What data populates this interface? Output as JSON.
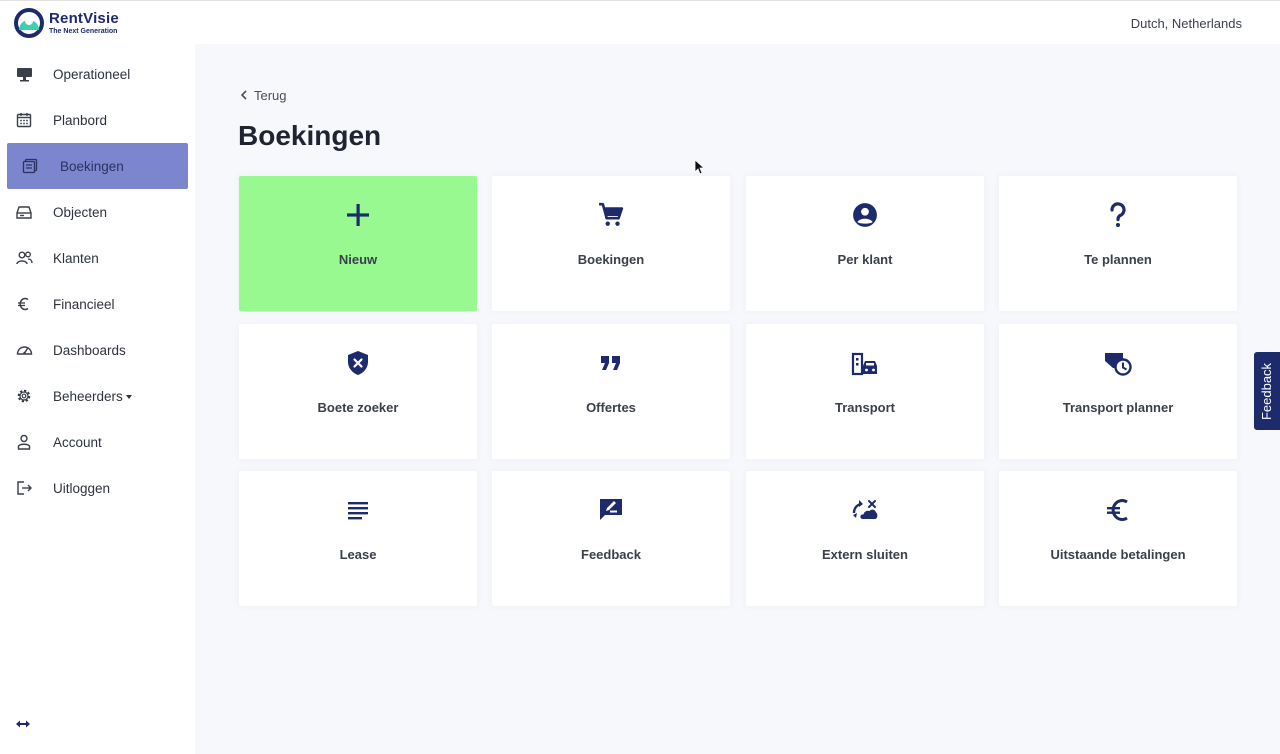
{
  "brand": {
    "name": "RentVisie",
    "tagline": "The Next Generation"
  },
  "header": {
    "locale": "Dutch, Netherlands"
  },
  "colors": {
    "navy": "#1d2a6b",
    "active": "#7b86cf",
    "tile_new": "#97f98f",
    "page_bg": "#f7f8fc"
  },
  "sidebar": {
    "items": [
      {
        "label": "Operationeel",
        "icon": "monitor-icon"
      },
      {
        "label": "Planbord",
        "icon": "calendar-icon"
      },
      {
        "label": "Boekingen",
        "icon": "bookings-icon",
        "active": true
      },
      {
        "label": "Objecten",
        "icon": "drive-icon"
      },
      {
        "label": "Klanten",
        "icon": "people-icon"
      },
      {
        "label": "Financieel",
        "icon": "euro-icon"
      },
      {
        "label": "Dashboards",
        "icon": "gauge-icon"
      },
      {
        "label": "Beheerders",
        "icon": "gear-icon",
        "dropdown": true
      },
      {
        "label": "Account",
        "icon": "user-icon"
      },
      {
        "label": "Uitloggen",
        "icon": "logout-icon"
      }
    ],
    "collapse_icon": "collapse-arrows-icon"
  },
  "main": {
    "back_label": "Terug",
    "title": "Boekingen",
    "tiles": [
      {
        "label": "Nieuw",
        "icon": "plus-icon"
      },
      {
        "label": "Boekingen",
        "icon": "cart-icon"
      },
      {
        "label": "Per klant",
        "icon": "account-circle-icon"
      },
      {
        "label": "Te plannen",
        "icon": "question-icon"
      },
      {
        "label": "Boete zoeker",
        "icon": "shield-x-icon"
      },
      {
        "label": "Offertes",
        "icon": "quote-icon"
      },
      {
        "label": "Transport",
        "icon": "city-car-icon"
      },
      {
        "label": "Transport planner",
        "icon": "truck-clock-icon"
      },
      {
        "label": "Lease",
        "icon": "lines-icon"
      },
      {
        "label": "Feedback",
        "icon": "feedback-icon"
      },
      {
        "label": "Extern sluiten",
        "icon": "cloud-swap-icon"
      },
      {
        "label": "Uitstaande betalingen",
        "icon": "euro-icon"
      }
    ]
  },
  "feedback_tab": {
    "label": "Feedback"
  }
}
